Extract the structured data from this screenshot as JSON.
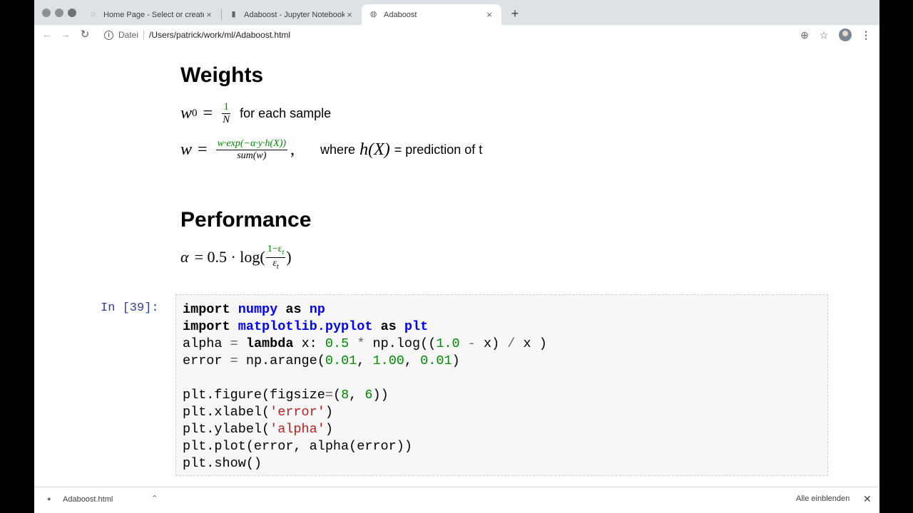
{
  "browser": {
    "tabs": [
      {
        "title": "Home Page - Select or create",
        "icon": "jupyter-icon"
      },
      {
        "title": "Adaboost - Jupyter Notebook",
        "icon": "notebook-icon"
      },
      {
        "title": "Adaboost",
        "icon": "globe-icon",
        "active": true
      }
    ],
    "new_tab_label": "+",
    "close_label": "×",
    "scheme_label": "Datei",
    "url": "/Users/patrick/work/ml/Adaboost.html"
  },
  "notebook": {
    "weights_heading": "Weights",
    "eq1": {
      "w0": "w",
      "sub": "0",
      "eq": "=",
      "num": "1",
      "den": "N",
      "text": "for each sample"
    },
    "eq2": {
      "w": "w",
      "eq": "=",
      "num": "w·exp(−α·y·h(X))",
      "den": "sum(w)",
      "comma": ",",
      "where": "where",
      "hx": "h(X)",
      "rest": "= prediction of t"
    },
    "performance_heading": "Performance",
    "eq3": {
      "alpha": "α",
      "rest": "= 0.5 · log(",
      "num": "1−ε",
      "den": "ε",
      "sub": "t",
      "close": ")"
    },
    "prompt": "In [39]:",
    "code": {
      "l1_kw1": "import",
      "l1_mod": "numpy",
      "l1_kw2": "as",
      "l1_alias": "np",
      "l2_kw1": "import",
      "l2_mod": "matplotlib.pyplot",
      "l2_kw2": "as",
      "l2_alias": "plt",
      "l3_a": "alpha ",
      "l3_eq": "=",
      "l3_kw": "lambda",
      "l3_b": " x: ",
      "l3_n1": "0.5",
      "l3_c": " ",
      "l3_star": "*",
      "l3_d": " np.log((",
      "l3_n2": "1.0",
      "l3_e": " ",
      "l3_minus": "-",
      "l3_f": " x) ",
      "l3_slash": "/",
      "l3_g": " x )",
      "l4_a": "error ",
      "l4_eq": "=",
      "l4_b": " np.arange(",
      "l4_n1": "0.01",
      "l4_c": ", ",
      "l4_n2": "1.00",
      "l4_d": ", ",
      "l4_n3": "0.01",
      "l4_e": ")",
      "l6_a": "plt.figure(figsize",
      "l6_eq": "=",
      "l6_b": "(",
      "l6_n1": "8",
      "l6_c": ", ",
      "l6_n2": "6",
      "l6_d": "))",
      "l7_a": "plt.xlabel(",
      "l7_s": "'error'",
      "l7_b": ")",
      "l8_a": "plt.ylabel(",
      "l8_s": "'alpha'",
      "l8_b": ")",
      "l9": "plt.plot(error, alpha(error))",
      "l10": "plt.show()"
    }
  },
  "downloads": {
    "file_name": "Adaboost.html",
    "chevron": "⌃",
    "show_all": "Alle einblenden",
    "close": "✕"
  }
}
